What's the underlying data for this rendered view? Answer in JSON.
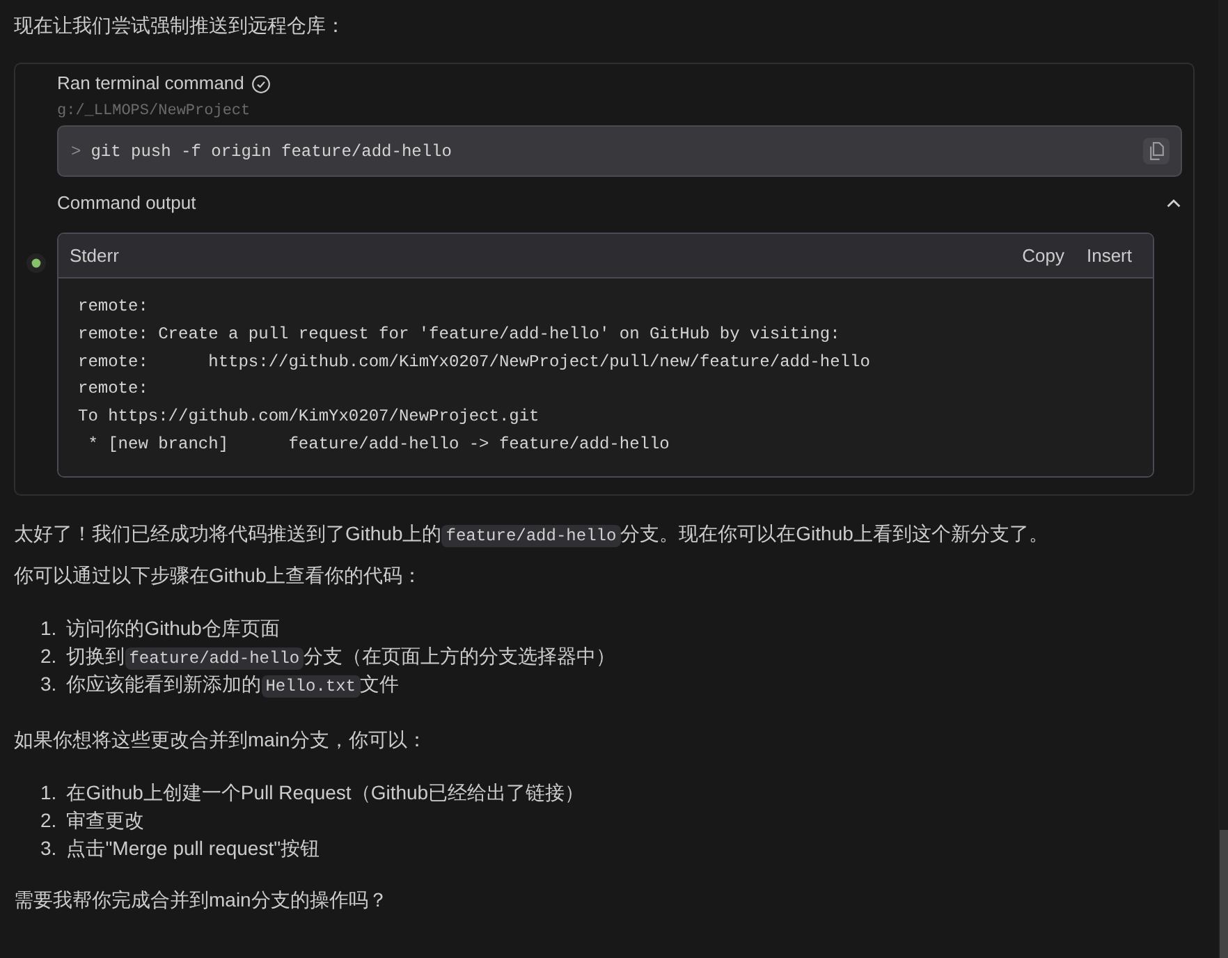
{
  "intro": "现在让我们尝试强制推送到远程仓库：",
  "terminal": {
    "title": "Ran terminal command",
    "completed": true,
    "cwd": "g:/_LLMOPS/NewProject",
    "prompt": ">",
    "command": "git push -f origin feature/add-hello",
    "output_label": "Command output",
    "output_expanded": true,
    "output": {
      "stream": "Stderr",
      "actions": [
        "Copy",
        "Insert"
      ],
      "lines": [
        "remote:",
        "remote: Create a pull request for 'feature/add-hello' on GitHub by visiting:",
        "remote:      https://github.com/KimYx0207/NewProject/pull/new/feature/add-hello",
        "remote:",
        "To https://github.com/KimYx0207/NewProject.git",
        " * [new branch]      feature/add-hello -> feature/add-hello"
      ]
    }
  },
  "summary": [
    {
      "kind": "text",
      "text": "太好了！我们已经成功将代码推送到了Github上的"
    },
    {
      "kind": "code",
      "text": "feature/add-hello"
    },
    {
      "kind": "text",
      "text": "分支。现在你可以在Github上看到这个新分支了。"
    }
  ],
  "steps_intro": "你可以通过以下步骤在Github上查看你的代码：",
  "steps": [
    {
      "number": "1.",
      "parts": [
        {
          "kind": "text",
          "text": "访问你的Github仓库页面"
        }
      ]
    },
    {
      "number": "2.",
      "parts": [
        {
          "kind": "text",
          "text": "切换到"
        },
        {
          "kind": "code",
          "text": "feature/add-hello"
        },
        {
          "kind": "text",
          "text": "分支（在页面上方的分支选择器中）"
        }
      ]
    },
    {
      "number": "3.",
      "parts": [
        {
          "kind": "text",
          "text": "你应该能看到新添加的"
        },
        {
          "kind": "code",
          "text": "Hello.txt"
        },
        {
          "kind": "text",
          "text": "文件"
        }
      ]
    }
  ],
  "merge_intro": "如果你想将这些更改合并到main分支，你可以：",
  "merge_steps": [
    {
      "number": "1.",
      "parts": [
        {
          "kind": "text",
          "text": "在Github上创建一个Pull Request（Github已经给出了链接）"
        }
      ]
    },
    {
      "number": "2.",
      "parts": [
        {
          "kind": "text",
          "text": "审查更改"
        }
      ]
    },
    {
      "number": "3.",
      "parts": [
        {
          "kind": "text",
          "text": "点击\"Merge pull request\"按钮"
        }
      ]
    }
  ],
  "closing": "需要我帮你完成合并到main分支的操作吗？"
}
